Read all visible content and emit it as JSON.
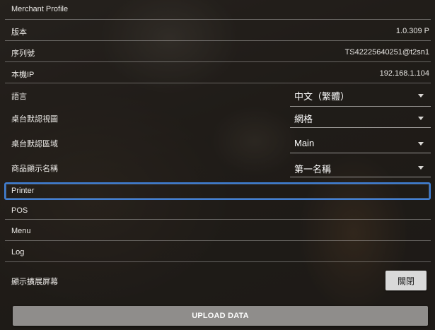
{
  "settings": {
    "merchant_profile": "Merchant Profile",
    "version_label": "版本",
    "version_value": "1.0.309 P",
    "serial_label": "序列號",
    "serial_value": "TS42225640251@t2sn1",
    "ip_label": "本機IP",
    "ip_value": "192.168.1.104",
    "language_label": "語言",
    "language_value": "中文（繁體）",
    "table_view_label": "桌台默認視圖",
    "table_view_value": "網格",
    "table_area_label": "桌台默認區域",
    "table_area_value": "Main",
    "product_name_label": "商品顯示名稱",
    "product_name_value": "第一名稱",
    "printer": "Printer",
    "pos": "POS",
    "menu": "Menu",
    "log": "Log",
    "extended_screen_label": "顯示擴展屏幕",
    "extended_screen_button": "關閉",
    "upload_button": "UPLOAD DATA"
  }
}
